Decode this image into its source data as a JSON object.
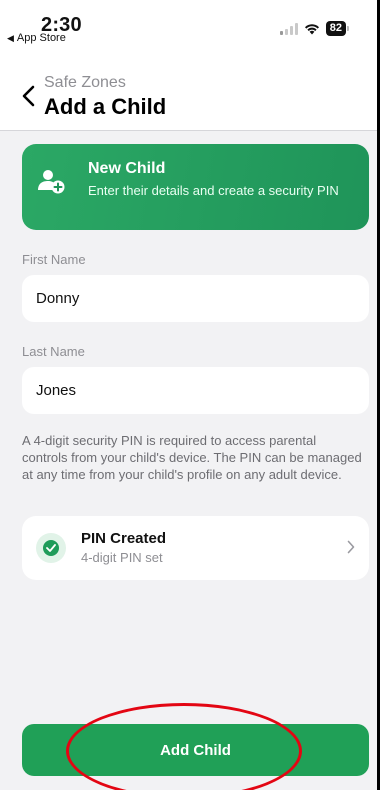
{
  "status_bar": {
    "time": "2:30",
    "back_app_label": "App Store",
    "battery_level": "82",
    "signal_icon": "cellular-signal-icon",
    "wifi_icon": "wifi-icon"
  },
  "nav": {
    "back_icon": "chevron-left-icon",
    "parent_title": "Safe Zones",
    "title": "Add a Child"
  },
  "banner": {
    "icon": "add-person-icon",
    "title": "New Child",
    "description": "Enter their details and create a security PIN",
    "color": "#1f9c5a"
  },
  "form": {
    "first_name_label": "First Name",
    "first_name_value": "Donny",
    "last_name_label": "Last Name",
    "last_name_value": "Jones",
    "info_text": "A 4-digit security PIN is required to access parental controls from your child's device. The PIN can be managed at any time from your child's profile on any adult device."
  },
  "pin": {
    "icon": "check-circle-icon",
    "title": "PIN Created",
    "subtitle": "4-digit PIN set",
    "chevron_icon": "chevron-right-icon"
  },
  "actions": {
    "add_child_label": "Add Child",
    "accent_color": "#20a057",
    "annotation_color": "#e30613"
  }
}
